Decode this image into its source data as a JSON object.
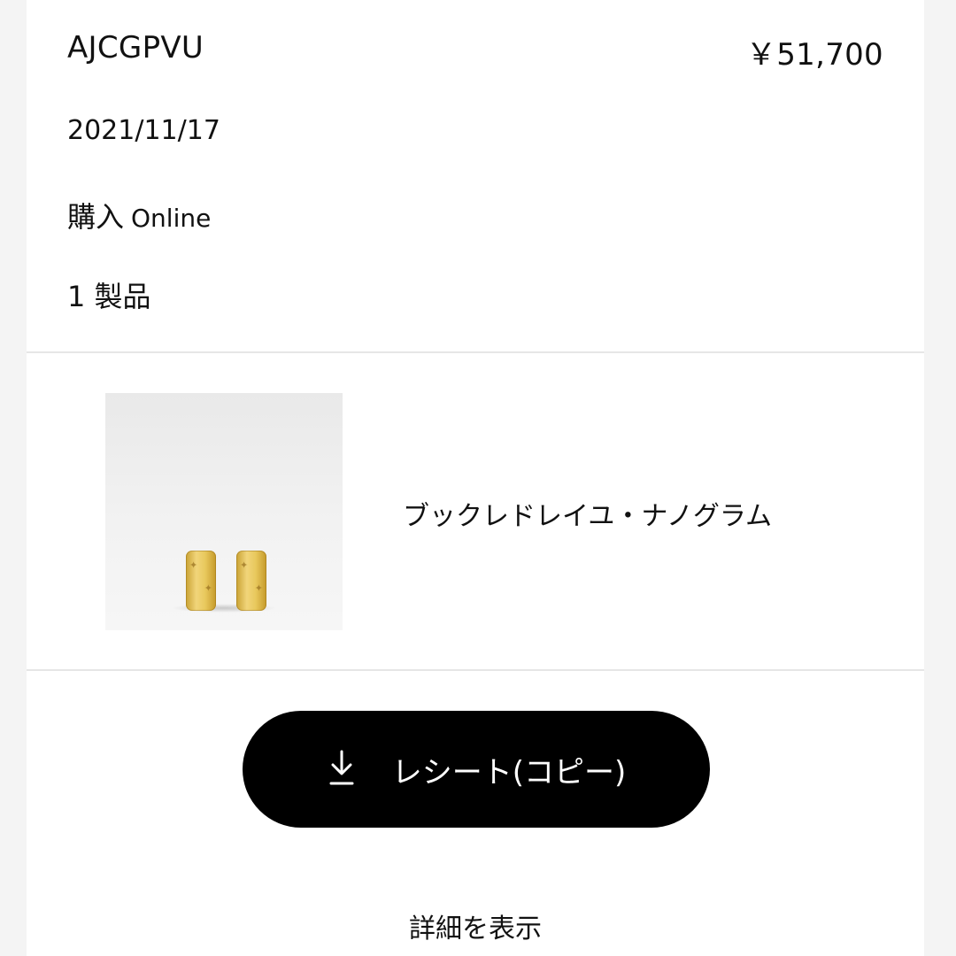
{
  "order": {
    "code": "AJCGPVU",
    "price": "￥51,700",
    "date": "2021/11/17",
    "purchase_label": "購入",
    "purchase_channel": "Online",
    "product_count": "1 製品"
  },
  "product": {
    "name": "ブックレドレイユ・ナノグラム",
    "image_icon": "earring-product-image"
  },
  "actions": {
    "receipt_label": "レシート(コピー)",
    "receipt_icon": "download-icon",
    "details_label": "詳細を表示"
  },
  "colors": {
    "background": "#f4f4f4",
    "card": "#ffffff",
    "button": "#000000",
    "button_text": "#ffffff",
    "divider": "#e6e6e6",
    "gold": "#e8c85c"
  }
}
